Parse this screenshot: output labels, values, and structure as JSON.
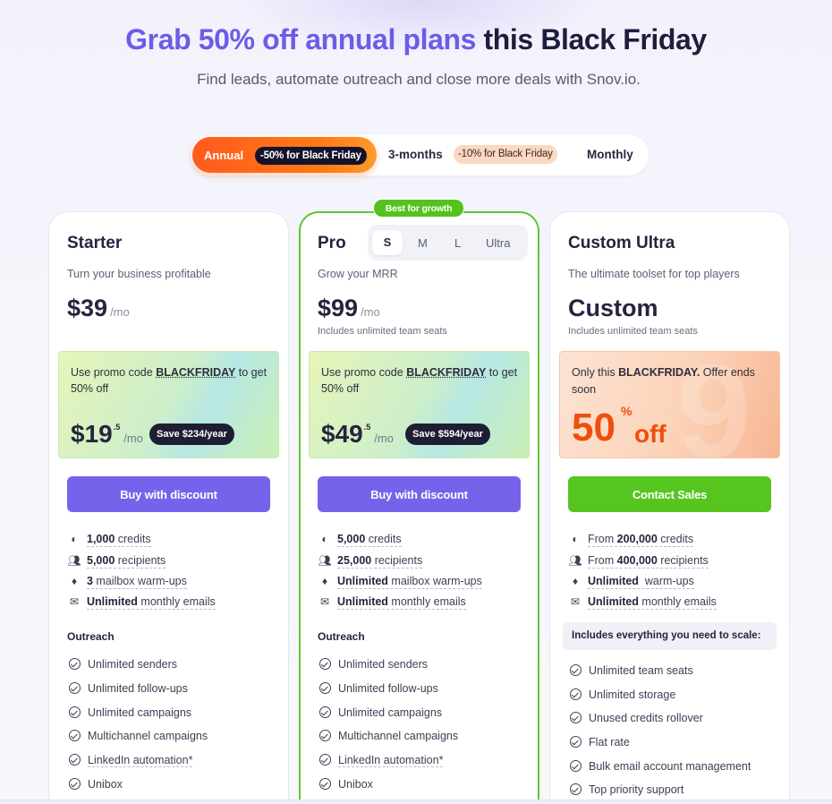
{
  "header": {
    "headline_highlight": "Grab 50% off annual plans",
    "headline_rest": "this Black Friday",
    "subtitle": "Find leads, automate outreach and close more deals with Snov.io."
  },
  "billing_toggle": {
    "annual_label": "Annual",
    "annual_badge": "-50% for Black Friday",
    "three_months_label": "3-months",
    "three_months_badge": "-10% for Black Friday",
    "monthly_label": "Monthly",
    "selected": "Annual"
  },
  "colors": {
    "accent_purple": "#6c5ce7",
    "button_purple": "#7563ec",
    "button_green": "#57c51f",
    "annual_orange": "#ff6a1a",
    "offer_orange": "#f04e0c"
  },
  "plans": [
    {
      "name": "Starter",
      "description": "Turn your business profitable",
      "price": "$39",
      "per": "/mo",
      "promo_pre": "Use promo code ",
      "promo_code": "BLACKFRIDAY",
      "promo_post": " to get 50% off",
      "discount_price": "$19",
      "discount_cents": ".5",
      "discount_per": "/mo",
      "save": "Save $234/year",
      "cta": "Buy with discount",
      "features": [
        {
          "icon": "coins-icon",
          "bold": "1,000",
          "text": " credits"
        },
        {
          "icon": "users-icon",
          "bold": "5,000",
          "text": " recipients"
        },
        {
          "icon": "flame-icon",
          "bold": "3",
          "text": " mailbox warm-ups"
        },
        {
          "icon": "mail-icon",
          "bold": "Unlimited",
          "text": " monthly emails"
        }
      ],
      "section": "Outreach",
      "checks": [
        "Unlimited senders",
        "Unlimited follow-ups",
        "Unlimited campaigns",
        "Multichannel campaigns",
        "LinkedIn automation*",
        "Unibox"
      ]
    },
    {
      "name": "Pro",
      "badge": "Best for growth",
      "sizes": [
        "S",
        "M",
        "L",
        "Ultra"
      ],
      "selected_size": "S",
      "description": "Grow your MRR",
      "price": "$99",
      "per": "/mo",
      "seats": "Includes unlimited team seats",
      "promo_pre": "Use promo code ",
      "promo_code": "BLACKFRIDAY",
      "promo_post": " to get 50% off",
      "discount_price": "$49",
      "discount_cents": ".5",
      "discount_per": "/mo",
      "save": "Save $594/year",
      "cta": "Buy with discount",
      "features": [
        {
          "icon": "coins-icon",
          "bold": "5,000",
          "text": " credits"
        },
        {
          "icon": "users-icon",
          "bold": "25,000",
          "text": " recipients"
        },
        {
          "icon": "flame-icon",
          "bold": "Unlimited",
          "text": " mailbox warm-ups"
        },
        {
          "icon": "mail-icon",
          "bold": "Unlimited",
          "text": " monthly emails"
        }
      ],
      "section": "Outreach",
      "checks": [
        "Unlimited senders",
        "Unlimited follow-ups",
        "Unlimited campaigns",
        "Multichannel campaigns",
        "LinkedIn automation*",
        "Unibox"
      ]
    },
    {
      "name": "Custom Ultra",
      "description": "The ultimate toolset for top players",
      "price": "Custom",
      "seats": "Includes unlimited team seats",
      "offer_pre": "Only this ",
      "offer_bold": "BLACKFRIDAY.",
      "offer_post": " Offer ends soon",
      "offer_number": "50",
      "offer_percent": "%",
      "offer_off": "off",
      "cta": "Contact Sales",
      "features": [
        {
          "icon": "coins-icon",
          "pre": "From ",
          "bold": "200,000",
          "text": " credits"
        },
        {
          "icon": "users-icon",
          "pre": "From ",
          "bold": "400,000",
          "text": " recipients"
        },
        {
          "icon": "flame-icon",
          "bold": "Unlimited",
          "text": "  warm-ups"
        },
        {
          "icon": "mail-icon",
          "bold": "Unlimited",
          "text": " monthly emails"
        }
      ],
      "section": "Includes everything you need to scale:",
      "checks": [
        "Unlimited team seats",
        "Unlimited storage",
        "Unused credits rollover",
        "Flat rate",
        "Bulk email account management",
        "Top priority support"
      ]
    }
  ]
}
